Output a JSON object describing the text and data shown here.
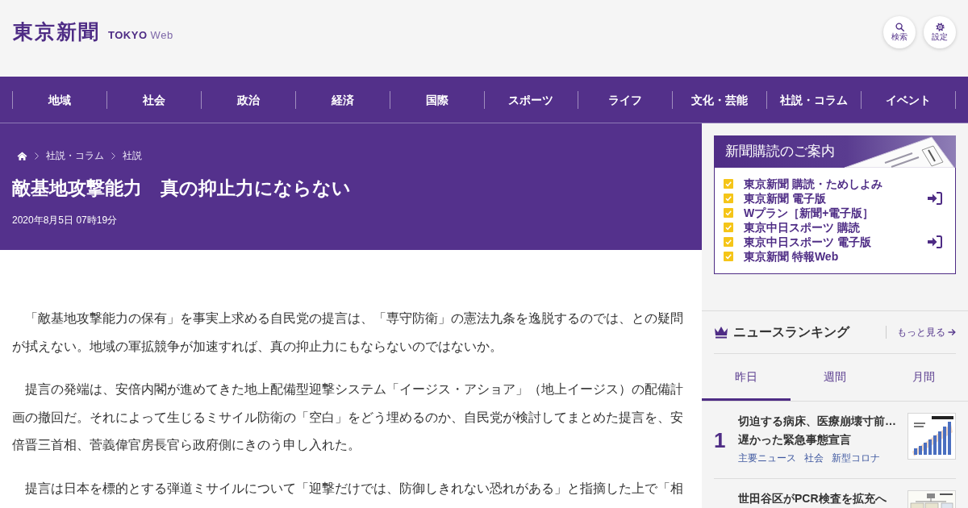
{
  "header": {
    "logo": {
      "name": "東京新聞",
      "subtitle": "**TOKYO** Web"
    },
    "buttons": [
      {
        "kind": "search",
        "label": "検索"
      },
      {
        "kind": "settings",
        "label": "設定"
      }
    ]
  },
  "nav": [
    "地域",
    "社会",
    "政治",
    "経済",
    "国際",
    "スポーツ",
    "ライフ",
    "文化・芸能",
    "社説・コラム",
    "イベント"
  ],
  "article": {
    "breadcrumb": [
      "社説・コラム",
      "社説"
    ],
    "title": "敵基地攻撃能力　真の抑止力にならない",
    "date": "2020年8月5日 07時19分",
    "paragraphs": [
      "「敵基地攻撃能力の保有」を事実上求める自民党の提言は、「専守防衛」の憲法九条を逸脱するのでは、との疑問が拭えない。地域の軍拡競争が加速すれば、真の抑止力にもならないのではないか。",
      "提言の発端は、安倍内閣が進めてきた地上配備型迎撃システム「イージス・アショア」（地上イージス）の配備計画の撤回だ。それによって生じるミサイル防衛の「空白」をどう埋めるのか、自民党が検討してまとめた提言を、安倍晋三首相、菅義偉官房長官ら政府側にきのう申し入れた。",
      "提言は日本を標的とする弾道ミサイルについて「迎撃だけでは、防御しきれない恐れがある」と指摘した上で「相"
    ]
  },
  "sidebar": {
    "subscription": {
      "title": "新聞購読のご案内",
      "groups": [
        {
          "items": [
            "東京新聞 購読・ためしよみ",
            "東京新聞 電子版",
            "Wプラン［新聞+電子版］"
          ]
        },
        {
          "items": [
            "東京中日スポーツ 購読",
            "東京中日スポーツ 電子版",
            "東京新聞 特報Web"
          ]
        }
      ]
    },
    "ranking": {
      "title": "ニュースランキング",
      "more": "もっと見る",
      "tabs": [
        {
          "label": "昨日",
          "selected": true
        },
        {
          "label": "週間",
          "selected": false
        },
        {
          "label": "月間",
          "selected": false
        }
      ],
      "items": [
        {
          "rank": "1",
          "title": "切迫する病床、医療崩壊寸前…\n遅かった緊急事態宣言",
          "tags": [
            "主要ニュース",
            "社会",
            "新型コロナ"
          ]
        },
        {
          "title": "世田谷区がPCR検査を拡充へ"
        }
      ]
    }
  }
}
